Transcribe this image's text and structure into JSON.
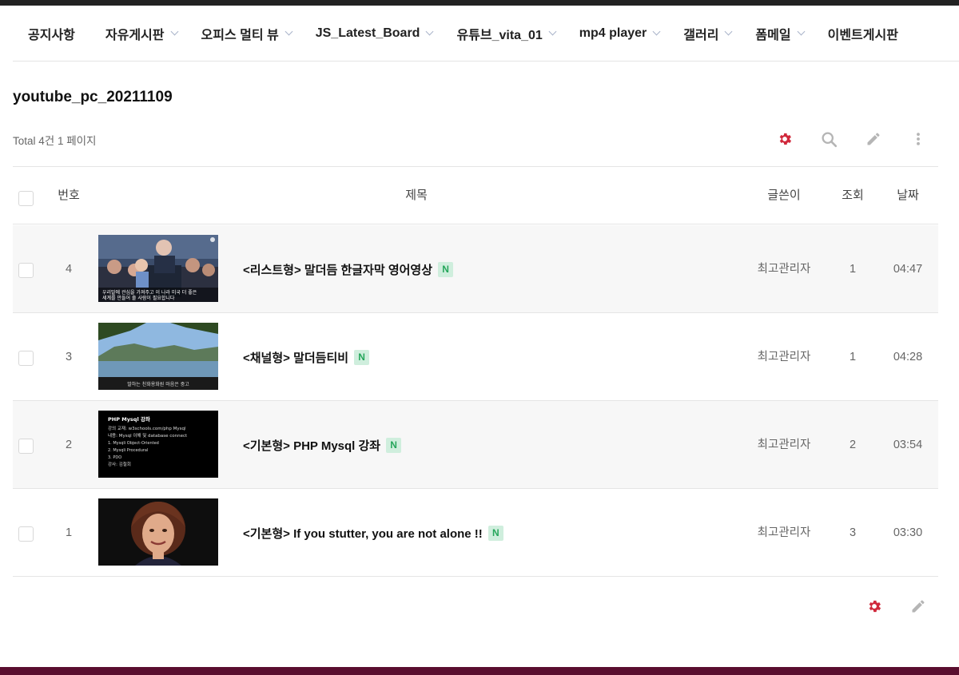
{
  "nav": {
    "items": [
      {
        "label": "공지사항",
        "has_dropdown": false
      },
      {
        "label": "자유게시판",
        "has_dropdown": true
      },
      {
        "label": "오피스 멀티 뷰",
        "has_dropdown": true
      },
      {
        "label": "JS_Latest_Board",
        "has_dropdown": true
      },
      {
        "label": "유튜브_vita_01",
        "has_dropdown": true
      },
      {
        "label": "mp4 player",
        "has_dropdown": true
      },
      {
        "label": "갤러리",
        "has_dropdown": true
      },
      {
        "label": "폼메일",
        "has_dropdown": true
      },
      {
        "label": "이벤트게시판",
        "has_dropdown": false
      }
    ]
  },
  "board": {
    "title": "youtube_pc_20211109",
    "total_text": "Total 4건 1 페이지"
  },
  "toolbar": {
    "icons": [
      "gear-icon",
      "search-icon",
      "pencil-icon",
      "more-vertical-icon"
    ]
  },
  "table": {
    "headers": {
      "num": "번호",
      "subject": "제목",
      "author": "글쓴이",
      "views": "조회",
      "date": "날짜"
    },
    "rows": [
      {
        "num": "4",
        "subject": "<리스트형> 말더듬 한글자막 영어영상",
        "badge": "N",
        "author": "최고관리자",
        "views": "1",
        "date": "04:47",
        "thumb": "rally"
      },
      {
        "num": "3",
        "subject": "<채널형> 말더듬티비",
        "badge": "N",
        "author": "최고관리자",
        "views": "1",
        "date": "04:28",
        "thumb": "lake"
      },
      {
        "num": "2",
        "subject": "<기본형> PHP Mysql 강좌",
        "badge": "N",
        "author": "최고관리자",
        "views": "2",
        "date": "03:54",
        "thumb": "slide"
      },
      {
        "num": "1",
        "subject": "<기본형> If you stutter, you are not alone !!",
        "badge": "N",
        "author": "최고관리자",
        "views": "3",
        "date": "03:30",
        "thumb": "woman"
      }
    ]
  },
  "thumbs": {
    "rally": {
      "caption1": "우리말에 관심을 가져주고 이 나라 미국 더 좋은",
      "caption2": "세계를 만들어 줄 사람이 필요합니다"
    },
    "lake": {
      "caption": "말하는 친화용화원 마음은 중고"
    },
    "slide": {
      "title": "PHP Mysql 강좌",
      "lines": [
        "강의 교재: w3schools.com/php Mysql",
        "내용: Mysql 이해 및 database connect",
        "1. Mysqli Object-Oriented",
        "2. Mysqli Procedural",
        "3. PDO",
        "강사: 김철회"
      ]
    }
  },
  "colors": {
    "accent_gear": "#d0283b",
    "icon_gray": "#b5b5b5",
    "badge_bg": "#cfeedd",
    "badge_text": "#26a65b",
    "bottom_bar": "#5a0e2f"
  }
}
